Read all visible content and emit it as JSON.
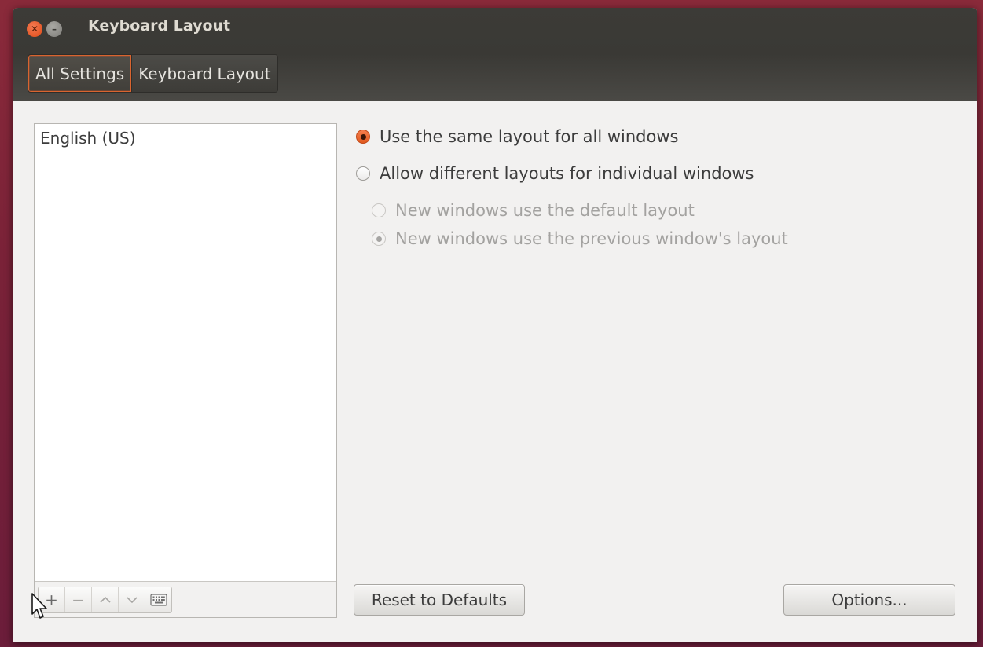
{
  "window": {
    "title": "Keyboard Layout",
    "controls": {
      "close_icon": "close-icon",
      "minimize_icon": "minimize-icon"
    }
  },
  "breadcrumb": {
    "items": [
      {
        "label": "All Settings"
      },
      {
        "label": "Keyboard Layout"
      }
    ]
  },
  "layouts": {
    "items": [
      "English (US)"
    ],
    "toolbar": {
      "add": "+",
      "remove": "−",
      "move_up": "⌃",
      "move_down": "⌄",
      "preview_icon": "keyboard-icon"
    }
  },
  "options": {
    "same_layout": {
      "label": "Use the same layout for all windows",
      "checked": true
    },
    "different_layouts": {
      "label": "Allow different layouts for individual windows",
      "checked": false
    },
    "new_default": {
      "label": "New windows use the default layout",
      "checked": false,
      "enabled": false
    },
    "new_previous": {
      "label": "New windows use the previous window's layout",
      "checked": true,
      "enabled": false
    }
  },
  "buttons": {
    "reset": "Reset to Defaults",
    "options": "Options..."
  },
  "colors": {
    "accent": "#e15a1f",
    "titlebar": "#3c3b37"
  }
}
